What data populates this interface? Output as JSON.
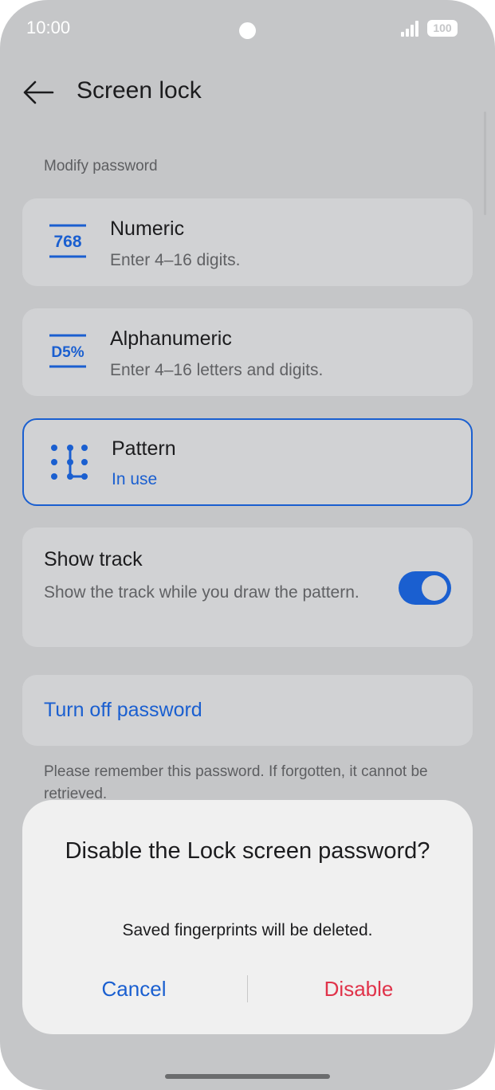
{
  "status_bar": {
    "time": "10:00",
    "battery": "100"
  },
  "header": {
    "title": "Screen lock"
  },
  "section": {
    "label": "Modify password"
  },
  "options": [
    {
      "title": "Numeric",
      "subtitle": "Enter 4–16 digits.",
      "icon": "numeric-password-icon",
      "icon_text": "768"
    },
    {
      "title": "Alphanumeric",
      "subtitle": "Enter 4–16 letters and digits.",
      "icon": "alphanumeric-password-icon",
      "icon_text": "D5%"
    },
    {
      "title": "Pattern",
      "subtitle": "In use",
      "icon": "pattern-password-icon",
      "selected": true
    }
  ],
  "show_track": {
    "title": "Show track",
    "description": "Show the track while you draw the pattern.",
    "enabled": true
  },
  "turn_off": {
    "label": "Turn off password"
  },
  "note": "Please remember this password. If forgotten, it cannot be retrieved.",
  "dialog": {
    "title": "Disable the Lock screen password?",
    "message": "Saved fingerprints will be deleted.",
    "cancel_label": "Cancel",
    "disable_label": "Disable"
  },
  "colors": {
    "accent": "#1a5fd0",
    "danger": "#e0334a",
    "background": "#c5c6c8"
  }
}
